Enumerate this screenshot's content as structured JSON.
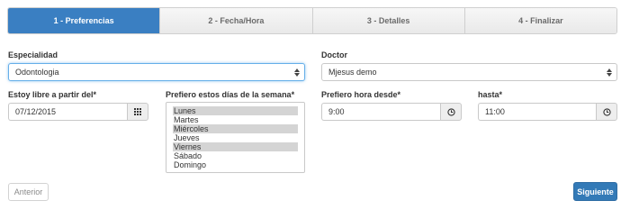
{
  "wizard": {
    "steps": [
      {
        "label": "1 - Preferencias",
        "active": true
      },
      {
        "label": "2 - Fecha/Hora",
        "active": false
      },
      {
        "label": "3 - Detalles",
        "active": false
      },
      {
        "label": "4 - Finalizar",
        "active": false
      }
    ]
  },
  "form": {
    "especialidad": {
      "label": "Especialidad",
      "value": "Odontologia"
    },
    "doctor": {
      "label": "Doctor",
      "value": "Mjesus demo"
    },
    "fecha": {
      "label": "Estoy libre a partir del*",
      "value": "07/12/2015",
      "icon": "calendar-grid-icon"
    },
    "dias": {
      "label": "Prefiero estos días de la semana*",
      "options": [
        {
          "text": "Lunes",
          "selected": true
        },
        {
          "text": "Martes",
          "selected": false
        },
        {
          "text": "Miércoles",
          "selected": true
        },
        {
          "text": "Jueves",
          "selected": false
        },
        {
          "text": "Viernes",
          "selected": true
        },
        {
          "text": "Sábado",
          "selected": false
        },
        {
          "text": "Domingo",
          "selected": false
        }
      ]
    },
    "hora_desde": {
      "label": "Prefiero hora desde*",
      "value": "9:00",
      "icon": "clock-icon"
    },
    "hora_hasta": {
      "label": "hasta*",
      "value": "11:00",
      "icon": "clock-icon"
    }
  },
  "buttons": {
    "anterior": "Anterior",
    "siguiente": "Siguiente"
  },
  "colors": {
    "primary": "#337ab7",
    "active_step": "#3a7fc2",
    "focus": "#66afe9"
  }
}
